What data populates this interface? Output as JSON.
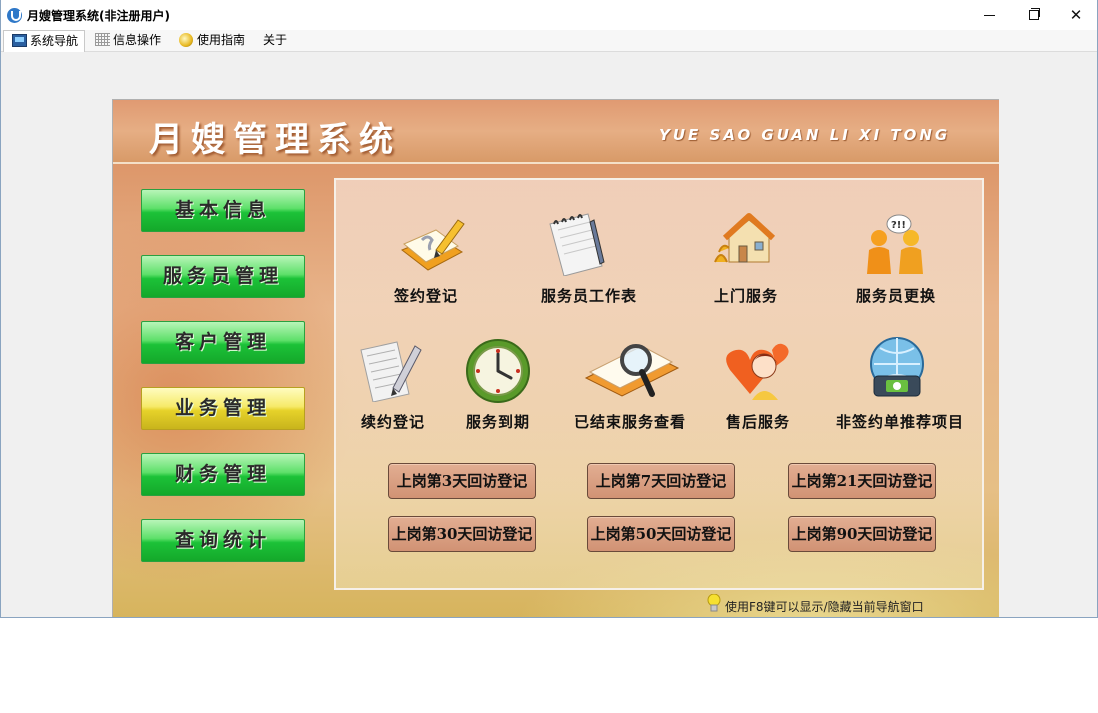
{
  "window": {
    "title": "月嫂管理系统(非注册用户)",
    "minimize_icon": "minimize-icon",
    "restore_icon": "restore-icon",
    "close_icon": "close-icon",
    "close_glyph": "✕"
  },
  "menubar": {
    "tabs": [
      {
        "label": "系统导航",
        "icon": "navigation-monitor-icon"
      },
      {
        "label": "信息操作",
        "icon": "grid-icon"
      },
      {
        "label": "使用指南",
        "icon": "guide-coin-icon"
      },
      {
        "label": "关于",
        "icon": ""
      }
    ]
  },
  "header": {
    "title": "月嫂管理系统",
    "subtitle": "YUE SAO GUAN LI XI TONG"
  },
  "side_nav": [
    {
      "label": "基本信息",
      "active": false
    },
    {
      "label": "服务员管理",
      "active": false
    },
    {
      "label": "客户管理",
      "active": false
    },
    {
      "label": "业务管理",
      "active": true
    },
    {
      "label": "财务管理",
      "active": false
    },
    {
      "label": "查询统计",
      "active": false
    }
  ],
  "features_row1": [
    {
      "label": "签约登记",
      "icon": "sign-contract-icon"
    },
    {
      "label": "服务员工作表",
      "icon": "notepad-icon"
    },
    {
      "label": "上门服务",
      "icon": "house-icon"
    },
    {
      "label": "服务员更换",
      "icon": "people-swap-icon"
    }
  ],
  "features_row2": [
    {
      "label": "续约登记",
      "icon": "document-pen-icon"
    },
    {
      "label": "服务到期",
      "icon": "clock-icon"
    },
    {
      "label": "已结束服务查看",
      "icon": "magnifier-icon"
    },
    {
      "label": "售后服务",
      "icon": "heart-girl-icon"
    },
    {
      "label": "非签约单推荐项目",
      "icon": "recommend-globe-icon"
    }
  ],
  "visit_buttons": [
    {
      "label": "上岗第3天回访登记"
    },
    {
      "label": "上岗第7天回访登记"
    },
    {
      "label": "上岗第21天回访登记"
    },
    {
      "label": "上岗第30天回访登记"
    },
    {
      "label": "上岗第50天回访登记"
    },
    {
      "label": "上岗第90天回访登记"
    }
  ],
  "tip": {
    "text": "使用F8键可以显示/隐藏当前导航窗口",
    "icon": "lightbulb-icon"
  },
  "colors": {
    "nav_green": "#1cc238",
    "nav_active_yellow": "#e6d22a",
    "visit_button": "#d19274",
    "header_orange": "#e09a72"
  }
}
